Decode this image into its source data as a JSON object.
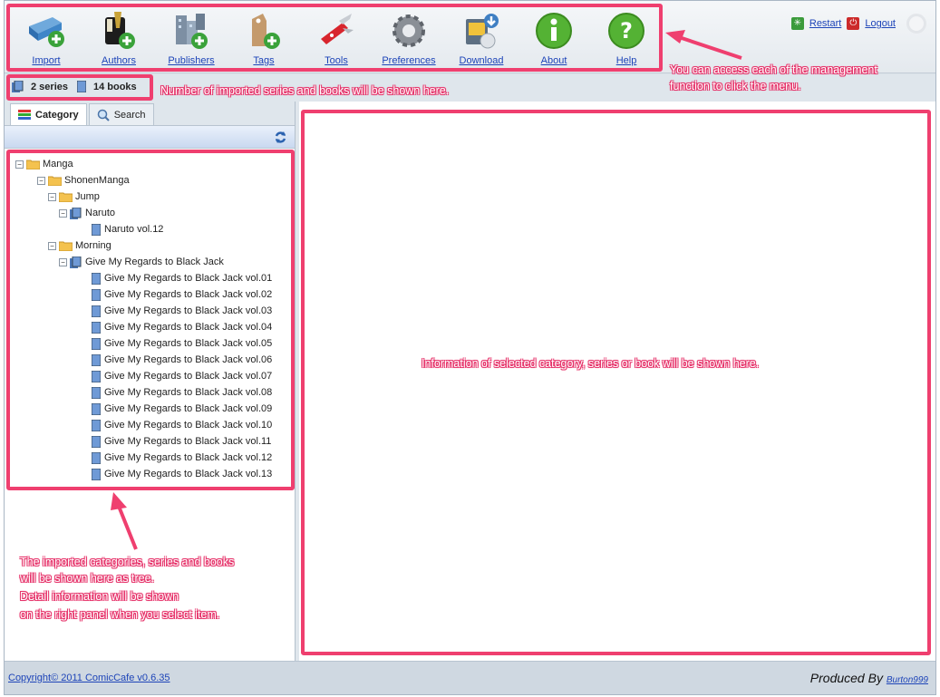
{
  "menu": [
    {
      "label": "Import",
      "icon": "import-icon"
    },
    {
      "label": "Authors",
      "icon": "authors-icon"
    },
    {
      "label": "Publishers",
      "icon": "publishers-icon"
    },
    {
      "label": "Tags",
      "icon": "tags-icon"
    },
    {
      "label": "Tools",
      "icon": "tools-icon"
    },
    {
      "label": "Preferences",
      "icon": "preferences-icon"
    },
    {
      "label": "Download",
      "icon": "download-icon"
    },
    {
      "label": "About",
      "icon": "about-icon"
    },
    {
      "label": "Help",
      "icon": "help-icon"
    }
  ],
  "topright": {
    "restart": "Restart",
    "logout": "Logout"
  },
  "status": {
    "series": "2 series",
    "books": "14 books"
  },
  "tabs": {
    "category": "Category",
    "search": "Search"
  },
  "tree": {
    "manga": "Manga",
    "shonen": "ShonenManga",
    "jump": "Jump",
    "naruto": "Naruto",
    "naruto_vol": "Naruto vol.12",
    "morning": "Morning",
    "bj": "Give My Regards to Black Jack",
    "bj_vols": [
      "Give My Regards to Black Jack vol.01",
      "Give My Regards to Black Jack vol.02",
      "Give My Regards to Black Jack vol.03",
      "Give My Regards to Black Jack vol.04",
      "Give My Regards to Black Jack vol.05",
      "Give My Regards to Black Jack vol.06",
      "Give My Regards to Black Jack vol.07",
      "Give My Regards to Black Jack vol.08",
      "Give My Regards to Black Jack vol.09",
      "Give My Regards to Black Jack vol.10",
      "Give My Regards to Black Jack vol.11",
      "Give My Regards to Black Jack vol.12",
      "Give My Regards to Black Jack vol.13"
    ]
  },
  "footer": {
    "copyright": "Copyright© 2011 ComicCafe v0.6.35",
    "produced": "Produced By",
    "author": "Burton999"
  },
  "annotations": {
    "menu1": "You can access each of the management",
    "menu2": "function to click the menu.",
    "counts": "Number of imported series and books will be shown here.",
    "tree1": "The imported categories, series and books",
    "tree2": "will be shown here as tree.",
    "tree3": "Detail information will be shown",
    "tree4": "on  the right panel when you select item.",
    "right": "Information of selected category, series or book will be shown here."
  },
  "colors": {
    "accent": "#ef3f6f",
    "link": "#1d44b8"
  }
}
